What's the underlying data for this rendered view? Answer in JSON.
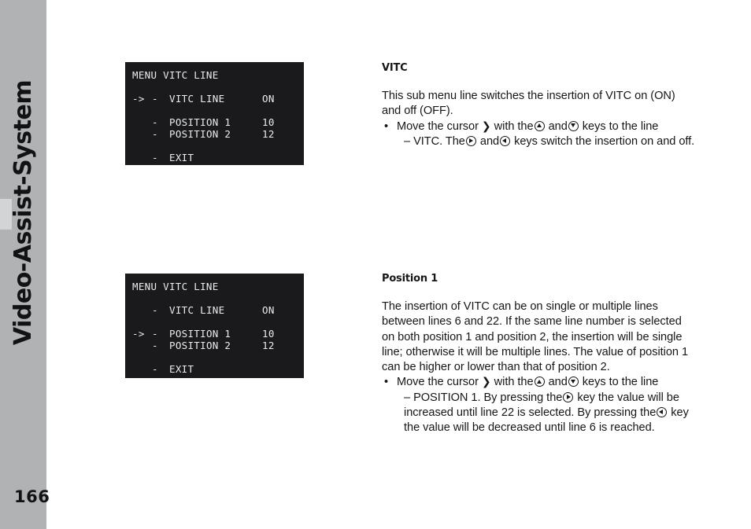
{
  "sidebar": {
    "title": "Video-Assist-System",
    "page_number": "166",
    "tab_marker": "chapter-tab"
  },
  "menus": [
    {
      "name": "vitc-line-menu-cursor-on-vitc-line",
      "title": "MENU VITC LINE",
      "rows": [
        {
          "cursor": "->",
          "dash": "-",
          "label": "VITC LINE",
          "value": "ON",
          "gap_before": false
        },
        {
          "cursor": "",
          "dash": "-",
          "label": "POSITION 1",
          "value": "10",
          "gap_before": true
        },
        {
          "cursor": "",
          "dash": "-",
          "label": "POSITION 2",
          "value": "12",
          "gap_before": false
        },
        {
          "cursor": "",
          "dash": "-",
          "label": "EXIT",
          "value": "",
          "gap_before": true
        }
      ]
    },
    {
      "name": "vitc-line-menu-cursor-on-position-1",
      "title": "MENU VITC LINE",
      "rows": [
        {
          "cursor": "",
          "dash": "-",
          "label": "VITC LINE",
          "value": "ON",
          "gap_before": false
        },
        {
          "cursor": "->",
          "dash": "-",
          "label": "POSITION 1",
          "value": "10",
          "gap_before": true
        },
        {
          "cursor": "",
          "dash": "-",
          "label": "POSITION 2",
          "value": "12",
          "gap_before": false
        },
        {
          "cursor": "",
          "dash": "-",
          "label": "EXIT",
          "value": "",
          "gap_before": true
        }
      ]
    }
  ],
  "sections": {
    "vitc": {
      "heading": "VITC",
      "paragraph": "This sub menu line switches the insertion of VITC on (ON) and off (OFF).",
      "bullet_marker": "•",
      "bullet_part1": "Move the cursor",
      "cursor_glyph": "❯",
      "bullet_part2": "with the",
      "bullet_part3": "and",
      "bullet_part4": "keys to the line",
      "bullet_cont1": "– VITC. The",
      "bullet_cont2": "and",
      "bullet_cont3": "keys switch the insertion on and off."
    },
    "position": {
      "heading": "Position 1",
      "paragraph": "The insertion of VITC can be on single or multiple lines between lines 6 and 22. If the same line number is selected on both position 1 and position 2, the insertion will be single line; otherwise it will be multiple lines. The value of position 1 can be higher or lower than that of position 2.",
      "bullet_marker": "•",
      "bullet_part1": "Move the cursor",
      "cursor_glyph": "❯",
      "bullet_part2": "with the",
      "bullet_part3": "and",
      "bullet_part4": "keys to the line",
      "bullet_cont1": "– POSITION 1. By pressing the",
      "bullet_cont2": "key the value will be increased until line 22 is selected. By pressing the",
      "bullet_cont3": "key the value will be decreased until line 6 is reached."
    }
  },
  "colors": {
    "sidebar_grey": "#b0b2b4",
    "sidebar_tab_grey": "#d3d4d6",
    "menu_background": "#1a1a1d",
    "menu_text": "#e9ecef",
    "body_text": "#161618",
    "page_background": "#ffffff"
  }
}
